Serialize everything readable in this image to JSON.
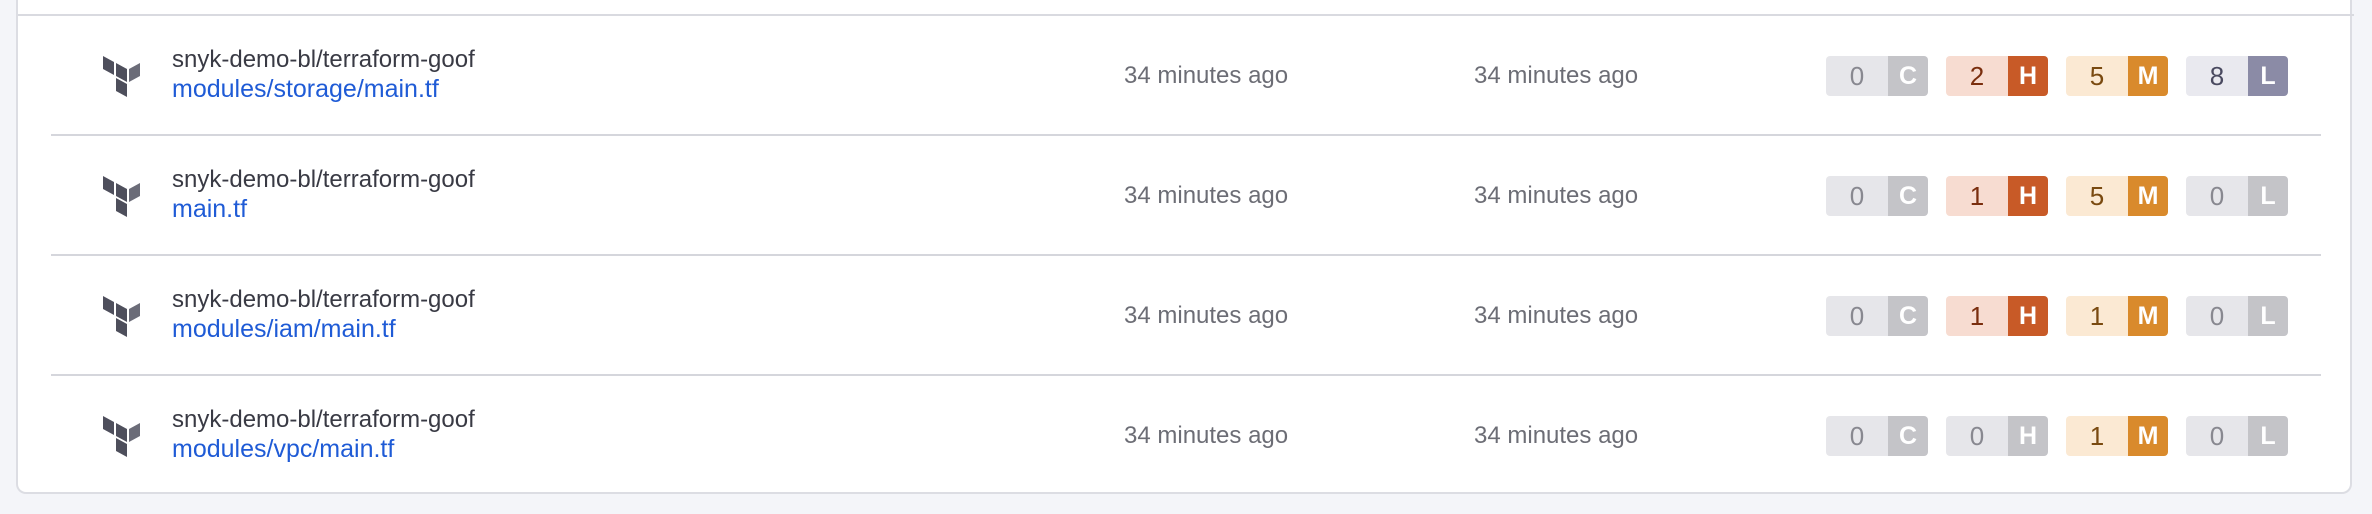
{
  "colors": {
    "link": "#1f5bd6",
    "critical_active": "#c4c4c8",
    "high_active": "#c85a27",
    "medium_active": "#d98a2c",
    "low_active": "#8b8ba6",
    "inactive_letter_bg": "#c4c4c8",
    "inactive_count_bg": "#e6e6ea"
  },
  "rows": [
    {
      "icon": "terraform-icon",
      "repo": "snyk-demo-bl/terraform-goof",
      "file": "modules/storage/main.tf",
      "imported": "34 minutes ago",
      "tested": "34 minutes ago",
      "issues": [
        {
          "count": "0",
          "letter": "C",
          "active": false
        },
        {
          "count": "2",
          "letter": "H",
          "active": true
        },
        {
          "count": "5",
          "letter": "M",
          "active": true
        },
        {
          "count": "8",
          "letter": "L",
          "active": true
        }
      ]
    },
    {
      "icon": "terraform-icon",
      "repo": "snyk-demo-bl/terraform-goof",
      "file": "main.tf",
      "imported": "34 minutes ago",
      "tested": "34 minutes ago",
      "issues": [
        {
          "count": "0",
          "letter": "C",
          "active": false
        },
        {
          "count": "1",
          "letter": "H",
          "active": true
        },
        {
          "count": "5",
          "letter": "M",
          "active": true
        },
        {
          "count": "0",
          "letter": "L",
          "active": false
        }
      ]
    },
    {
      "icon": "terraform-icon",
      "repo": "snyk-demo-bl/terraform-goof",
      "file": "modules/iam/main.tf",
      "imported": "34 minutes ago",
      "tested": "34 minutes ago",
      "issues": [
        {
          "count": "0",
          "letter": "C",
          "active": false
        },
        {
          "count": "1",
          "letter": "H",
          "active": true
        },
        {
          "count": "1",
          "letter": "M",
          "active": true
        },
        {
          "count": "0",
          "letter": "L",
          "active": false
        }
      ]
    },
    {
      "icon": "terraform-icon",
      "repo": "snyk-demo-bl/terraform-goof",
      "file": "modules/vpc/main.tf",
      "imported": "34 minutes ago",
      "tested": "34 minutes ago",
      "issues": [
        {
          "count": "0",
          "letter": "C",
          "active": false
        },
        {
          "count": "0",
          "letter": "H",
          "active": false
        },
        {
          "count": "1",
          "letter": "M",
          "active": true
        },
        {
          "count": "0",
          "letter": "L",
          "active": false
        }
      ]
    }
  ]
}
